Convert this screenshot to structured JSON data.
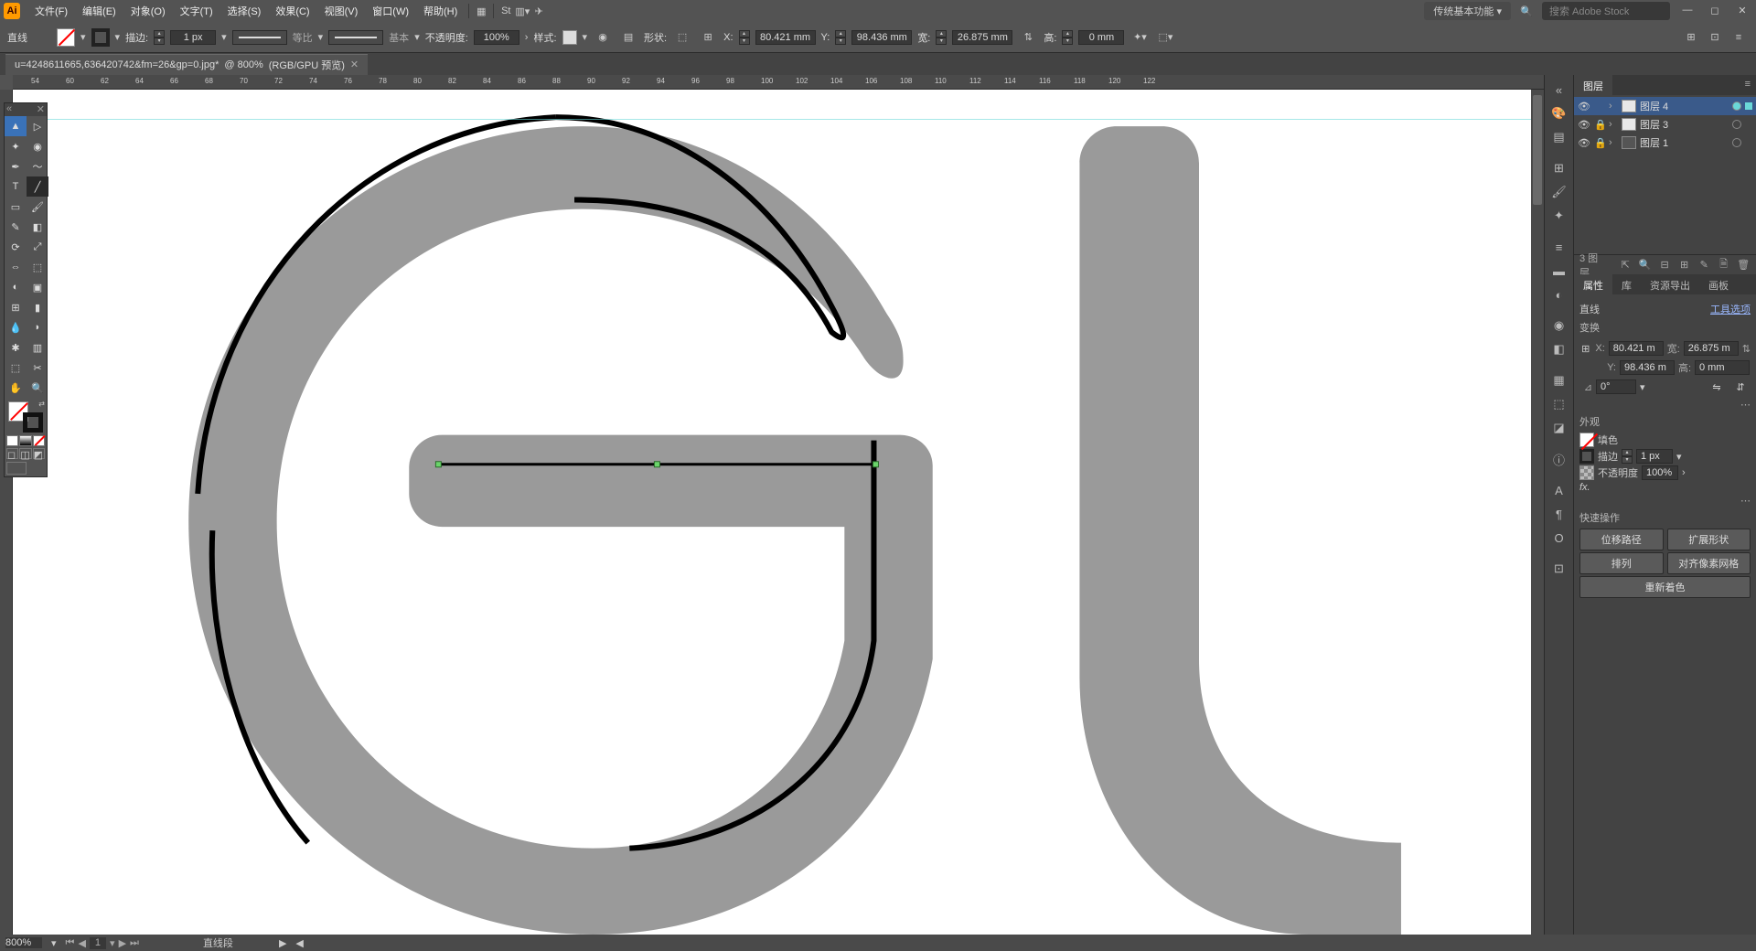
{
  "menu": {
    "file": "文件(F)",
    "edit": "编辑(E)",
    "object": "对象(O)",
    "type": "文字(T)",
    "select": "选择(S)",
    "effect": "效果(C)",
    "view": "视图(V)",
    "window": "窗口(W)",
    "help": "帮助(H)"
  },
  "workspace": "传统基本功能",
  "search_placeholder": "搜索 Adobe Stock",
  "control": {
    "object_type": "直线",
    "stroke_label": "描边:",
    "stroke_weight": "1 px",
    "profile": "等比",
    "brush": "基本",
    "opacity_label": "不透明度:",
    "opacity": "100%",
    "style_label": "样式:",
    "shape_label": "形状:",
    "x_label": "X:",
    "x": "80.421 mm",
    "y_label": "Y:",
    "y": "98.436 mm",
    "w_label": "宽:",
    "w": "26.875 mm",
    "h_label": "高:",
    "h": "0 mm"
  },
  "tab": {
    "filename": "u=4248611665,636420742&fm=26&gp=0.jpg*",
    "zoom": "800%",
    "mode": "(RGB/GPU 预览)"
  },
  "ruler_ticks": [
    "54",
    "60",
    "62",
    "64",
    "66",
    "68",
    "70",
    "72",
    "74",
    "76",
    "78",
    "80",
    "82",
    "84",
    "86",
    "88",
    "90",
    "92",
    "94",
    "96",
    "98",
    "100",
    "102",
    "104",
    "106",
    "108",
    "110",
    "112",
    "114",
    "116",
    "118",
    "120",
    "122"
  ],
  "layers_panel": {
    "title": "图层",
    "items": [
      {
        "name": "图层 4",
        "swatch": "#e8e8e8",
        "selected": true,
        "eye": true,
        "lock": false,
        "targeted": true
      },
      {
        "name": "图层 3",
        "swatch": "#e8e8e8",
        "selected": false,
        "eye": true,
        "lock": true,
        "targeted": false
      },
      {
        "name": "图层 1",
        "swatch": "#555555",
        "selected": false,
        "eye": true,
        "lock": true,
        "targeted": false
      }
    ],
    "footer_count": "3 图层"
  },
  "props_panel": {
    "tabs": {
      "props": "属性",
      "lib": "库",
      "asset": "资源导出",
      "artboard": "画板"
    },
    "object_type": "直线",
    "tool_options": "工具选项",
    "transform_title": "变换",
    "x": "80.421 m",
    "w": "26.875 m",
    "y": "98.436 m",
    "h": "0 mm",
    "angle": "0°",
    "appearance_title": "外观",
    "fill_label": "填色",
    "stroke_label": "描边",
    "stroke_weight": "1 px",
    "opacity_label": "不透明度",
    "opacity": "100%",
    "fx": "fx.",
    "quick_title": "快速操作",
    "btn_offset": "位移路径",
    "btn_expand": "扩展形状",
    "btn_arrange": "排列",
    "btn_pixel": "对齐像素网格",
    "btn_recolor": "重新着色"
  },
  "status": {
    "zoom": "800%",
    "artboard": "1",
    "selection": "直线段"
  }
}
